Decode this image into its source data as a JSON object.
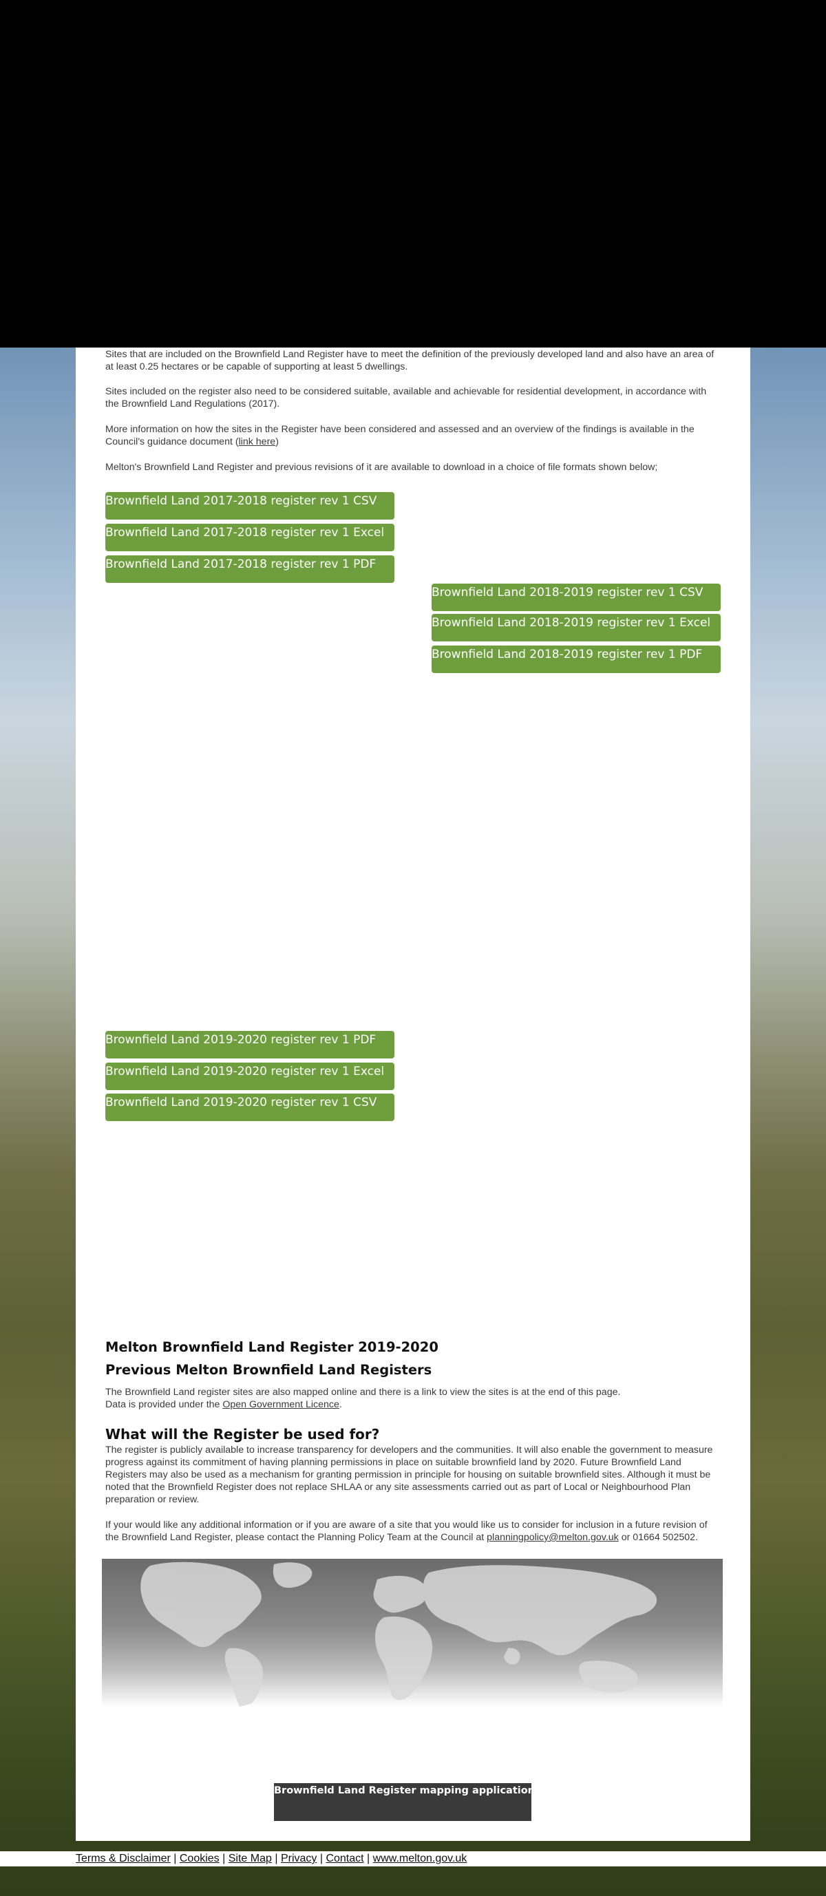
{
  "intro": {
    "para1": "Sites that are included on the Brownfield Land Register have to meet the definition of the previously developed land and also have an area of at least 0.25 hectares or be capable of supporting at least 5 dwellings.",
    "para2": "Sites included on the register also need to be considered suitable, available and achievable for residential development, in accordance with the Brownfield Land Regulations (2017).",
    "para3_before": "More information on how the sites in the Register have been considered and assessed and an overview of the findings is available in the Council's guidance document (",
    "para3_link": "link here",
    "para3_after": ")",
    "para4": "Melton's Brownfield Land Register and previous revisions of it are available to download in a choice of  file formats shown below;"
  },
  "downloads_2017": [
    "Brownfield Land 2017-2018 register rev 1 CSV",
    "Brownfield Land 2017-2018 register rev 1 Excel",
    "Brownfield Land 2017-2018 register rev 1 PDF"
  ],
  "downloads_2018": [
    "Brownfield Land 2018-2019 register rev 1 CSV",
    "Brownfield Land 2018-2019 register rev 1 Excel",
    "Brownfield Land 2018-2019 register rev 1 PDF"
  ],
  "downloads_2019": [
    "Brownfield Land 2019-2020 register rev 1 PDF",
    "Brownfield Land 2019-2020 register rev 1 Excel",
    "Brownfield Land 2019-2020 register rev 1 CSV"
  ],
  "headings": {
    "current": "Melton Brownfield Land Register 2019-2020",
    "previous": "Previous Melton Brownfield Land Registers",
    "usage": "What will the Register be used for?"
  },
  "mapped": {
    "line1": "The Brownfield Land register sites are also mapped online and there is a link to view the sites is at the end of this page.",
    "line2_before": "Data is provided under the ",
    "line2_link": "Open Government Licence",
    "line2_after": "."
  },
  "usage_text": "The register is publicly available to increase transparency for developers and the communities. It will also enable the government to measure progress against its commitment of having planning permissions in place on suitable brownfield land by 2020. Future Brownfield Land Registers may also be used as a mechanism for granting permission in principle for housing on suitable brownfield sites. Although it must be noted that the Brownfield Register does not replace SHLAA or any site assessments carried out as part of Local or Neighbourhood Plan preparation or review.",
  "contact": {
    "before": "If your would like any additional information or if you are aware of a site that you would like us to consider for inclusion in a future revision of the Brownfield Land Register, please contact the Planning Policy Team at the Council at ",
    "email": "planningpolicy@melton.gov.uk",
    "after": " or 01664 502502."
  },
  "map_app_button": "Brownfield Land Register mapping application",
  "footer": {
    "terms": "Terms & Disclaimer",
    "cookies": "Cookies",
    "sitemap": "Site Map",
    "privacy": "Privacy",
    "contact": "Contact",
    "website": "www.melton.gov.uk",
    "sep": "|"
  },
  "colors": {
    "button_green": "#6e9e3e",
    "map_button": "#3a3a3a",
    "link_blue": "#6f9ed1"
  }
}
